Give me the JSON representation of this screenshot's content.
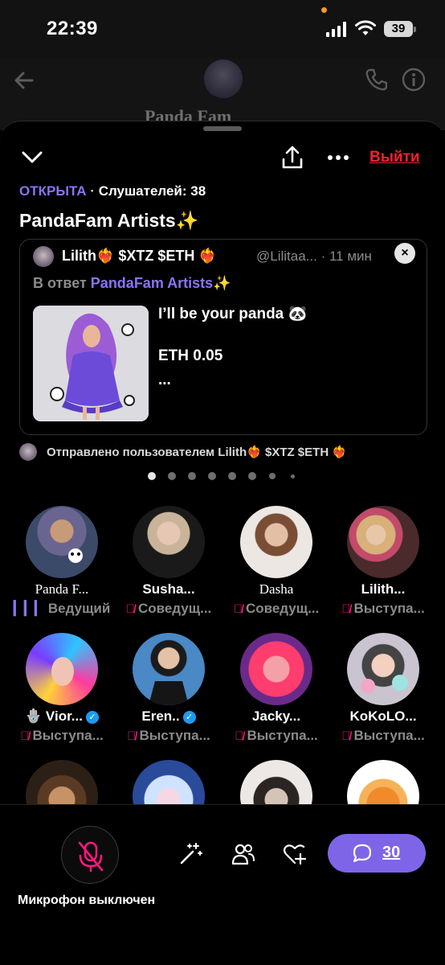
{
  "status_bar": {
    "time": "22:39",
    "battery": "39"
  },
  "background_chat": {
    "title": "Panda Fam"
  },
  "space": {
    "status": "ОТКРЫТА",
    "listeners_label": "Слушателей: 38",
    "title": "PandaFam Artists✨",
    "exit_label": "Выйти"
  },
  "pinned_post": {
    "author": "Lilith❤️‍🔥 $XTZ $ETH ❤️‍🔥",
    "handle_time": "@Lilitaa... · 11 мин",
    "reply_prefix": "В ответ",
    "reply_to": "PandaFam Artists✨",
    "line1": "I’ll be your panda 🐼",
    "line2": "ETH 0.05",
    "line3": "...",
    "close": "×"
  },
  "posted_by": "Отправлено пользователем Lilith❤️‍🔥 $XTZ $ETH ❤️‍🔥",
  "pagination": {
    "pages": 8,
    "active": 0
  },
  "participants": [
    {
      "name": "Panda F...",
      "role": "Ведущий",
      "muted": false
    },
    {
      "name": "Susha...",
      "role": "Соведущ...",
      "muted": true
    },
    {
      "name": "Dasha",
      "role": "Соведущ...",
      "muted": true
    },
    {
      "name": "Lilith...",
      "role": "Выступа...",
      "muted": true
    },
    {
      "name": "🪬 Vior...",
      "role": "Выступа...",
      "muted": true,
      "verified": true
    },
    {
      "name": "Eren..",
      "role": "Выступа...",
      "muted": true,
      "verified": true
    },
    {
      "name": "Jacky...",
      "role": "Выступа...",
      "muted": true
    },
    {
      "name": "KoKoLO...",
      "role": "Выступа...",
      "muted": true
    }
  ],
  "bottom_bar": {
    "mic_label": "Микрофон выключен",
    "comments_count": "30"
  },
  "colors": {
    "accent": "#8b73f5",
    "exit": "#f4212e",
    "muted_mic": "#f91880",
    "comments_button": "#7e65e8"
  }
}
